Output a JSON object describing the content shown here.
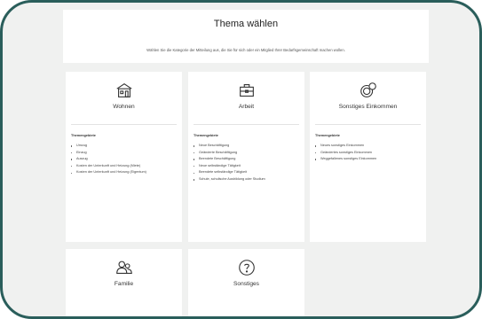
{
  "header": {
    "title": "Thema wählen",
    "subtitle": "Wählen Sie die Kategorie der Mitteilung aus, die Sie für sich oder ein Mitglied Ihrer Bedarfsgemeinschaft machen wollen."
  },
  "cards": [
    {
      "label": "Wohnen",
      "icon": "house-icon",
      "section_heading": "Themengebiete",
      "items": [
        "Umzug",
        "Einzug",
        "Auszug",
        "Kosten der Unterkunft und Heizung (Miete)",
        "Kosten der Unterkunft und Heizung (Eigentum)"
      ]
    },
    {
      "label": "Arbeit",
      "icon": "briefcase-icon",
      "section_heading": "Themengebiete",
      "items": [
        "Neue Beschäftigung",
        "Geänderte Beschäftigung",
        "Beendete Beschäftigung",
        "Neue selbständige Tätigkeit",
        "Beendete selbständige Tätigkeit",
        "Schule, schulische Ausbildung oder Studium"
      ]
    },
    {
      "label": "Sonstiges Einkommen",
      "icon": "coins-icon",
      "section_heading": "Themengebiete",
      "items": [
        "Neues sonstiges Einkommen",
        "Geändertes sonstiges Einkommen",
        "Weggefallenes sonstiges Einkommen"
      ]
    },
    {
      "label": "Familie",
      "icon": "family-icon"
    },
    {
      "label": "Sonstiges",
      "icon": "question-icon"
    }
  ]
}
